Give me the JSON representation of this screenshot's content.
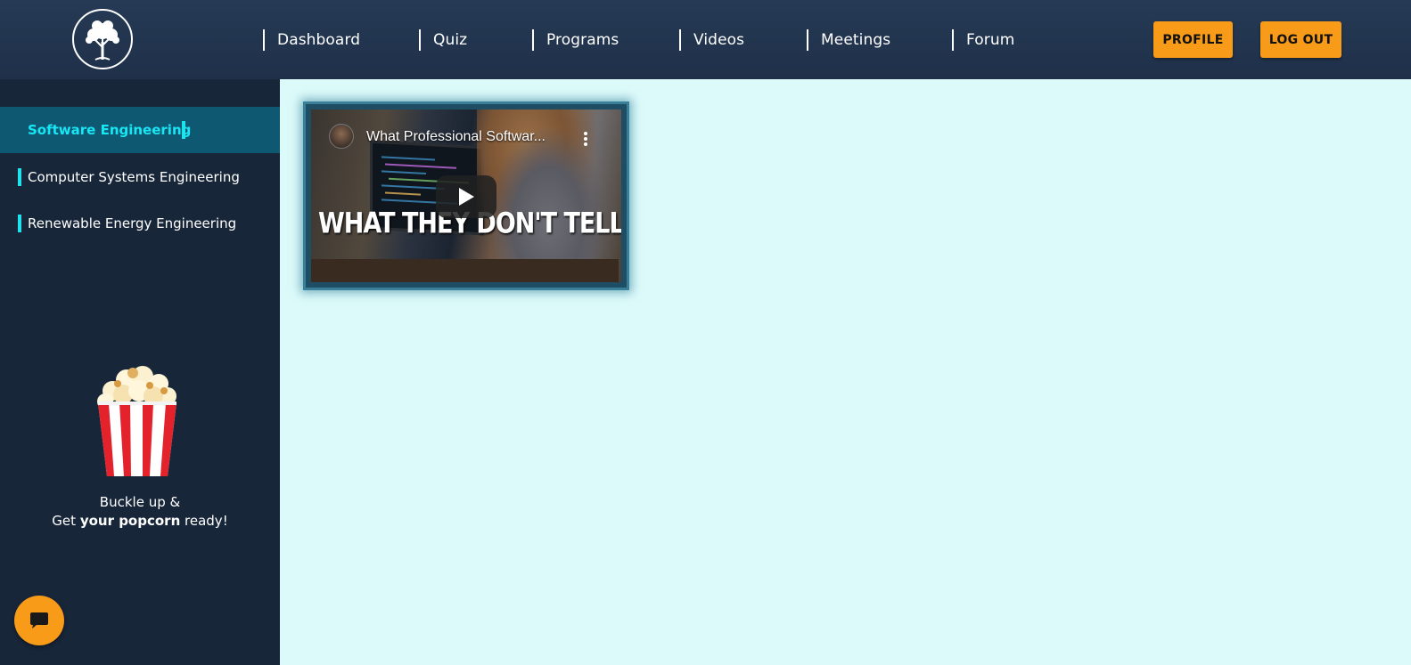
{
  "header": {
    "nav": [
      {
        "label": "Dashboard"
      },
      {
        "label": "Quiz"
      },
      {
        "label": "Programs"
      },
      {
        "label": "Videos"
      },
      {
        "label": "Meetings"
      },
      {
        "label": "Forum"
      }
    ],
    "profile_label": "PROFILE",
    "logout_label": "LOG OUT",
    "logo_icon": "tree-icon"
  },
  "sidebar": {
    "items": [
      {
        "label": "Software Engineering",
        "active": true
      },
      {
        "label": "Computer Systems Engineering",
        "active": false
      },
      {
        "label": "Renewable Energy Engineering",
        "active": false
      }
    ],
    "tagline_line1": "Buckle up &",
    "tagline_get": "Get",
    "tagline_bold": "your popcorn",
    "tagline_end": "ready!",
    "chat_icon": "chat-bubble-icon"
  },
  "main": {
    "videos": [
      {
        "title": "What Professional Softwar...",
        "thumbnail_text": "WHAT THEY DON'T TELL YOU"
      }
    ]
  },
  "colors": {
    "header_bg": "#223450",
    "sidebar_bg": "#18263a",
    "active_item_bg": "#0f5872",
    "accent_cyan": "#1de3ef",
    "button_orange": "#f79b18",
    "main_bg": "#dcfafa"
  }
}
